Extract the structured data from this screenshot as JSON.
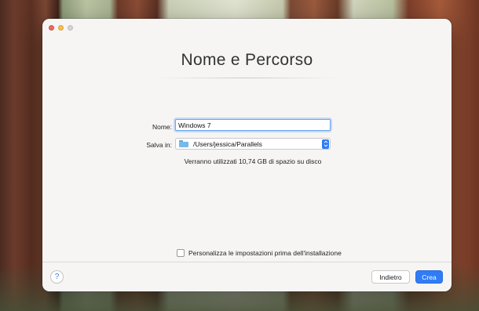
{
  "window": {
    "title": "Nome e Percorso"
  },
  "form": {
    "name_label": "Nome:",
    "name_value": "Windows 7",
    "save_label": "Salva in:",
    "save_path": "/Users/jessica/Parallels",
    "disk_info": "Verranno utilizzati 10,74 GB di spazio su disco",
    "customize_label": "Personalizza le impostazioni prima dell'installazione",
    "customize_checked": false
  },
  "footer": {
    "help_label": "?",
    "back_label": "Indietro",
    "create_label": "Crea"
  },
  "icons": {
    "folder": "folder-icon",
    "stepper": "chevron-up-down-icon",
    "help": "question-mark-icon"
  },
  "colors": {
    "accent": "#2f7cf6",
    "window_bg": "#f6f5f4",
    "close": "#ed6a5e",
    "minimize": "#f5bf4f",
    "zoom": "#d4d4d4"
  }
}
